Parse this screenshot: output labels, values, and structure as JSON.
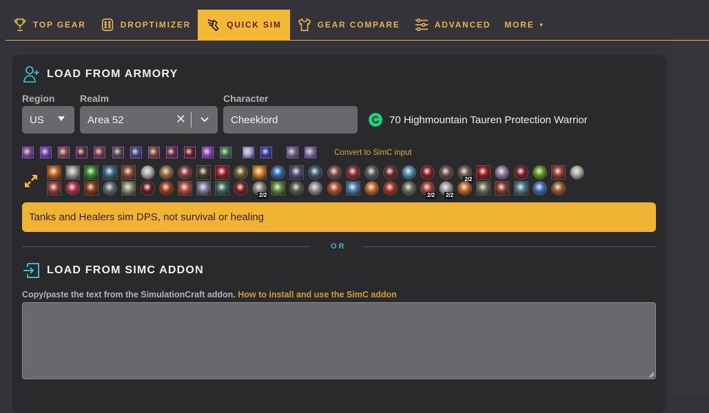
{
  "nav": {
    "items": [
      {
        "label": "TOP GEAR",
        "icon": "trophy-icon",
        "active": false
      },
      {
        "label": "DROPTIMIZER",
        "icon": "dice-icon",
        "active": false
      },
      {
        "label": "QUICK SIM",
        "icon": "winged-boot-icon",
        "active": true
      },
      {
        "label": "GEAR COMPARE",
        "icon": "shirt-icon",
        "active": false
      },
      {
        "label": "ADVANCED",
        "icon": "sliders-icon",
        "active": false
      },
      {
        "label": "MORE",
        "icon": "caret-down-icon",
        "active": false
      }
    ],
    "more_caret": "▼"
  },
  "armory": {
    "title": "LOAD FROM ARMORY",
    "region_label": "Region",
    "region_value": "US",
    "realm_label": "Realm",
    "realm_value": "Area 52",
    "realm_clear": "✕",
    "character_label": "Character",
    "character_value": "Cheeklord",
    "character_info": "70 Highmountain Tauren Protection Warrior",
    "convert_link": "Convert to SimC input",
    "gear_icons": [
      {
        "slot": "head",
        "color": "#7a4a8a"
      },
      {
        "slot": "neck",
        "color": "#6b3fa8"
      },
      {
        "slot": "shoulder",
        "color": "#8a4a3a"
      },
      {
        "slot": "back",
        "color": "#5e2a2a"
      },
      {
        "slot": "chest",
        "color": "#7a3a3a"
      },
      {
        "slot": "wrist",
        "color": "#5a4a3a"
      },
      {
        "slot": "hands",
        "color": "#3a4a7a"
      },
      {
        "slot": "waist",
        "color": "#7a4a2a"
      },
      {
        "slot": "legs",
        "color": "#6a2a3a"
      },
      {
        "slot": "feet",
        "color": "#6a1a1a"
      },
      {
        "slot": "finger1",
        "color": "#8a4ab0"
      },
      {
        "slot": "finger2",
        "color": "#3a7a3a"
      },
      {
        "slot": "trinket1",
        "color": "#a0a8c8"
      },
      {
        "slot": "trinket2",
        "color": "#2a3a9a"
      },
      {
        "slot": "main_hand",
        "color": "#6a6a7a"
      },
      {
        "slot": "off_hand",
        "color": "#7a7a9a"
      }
    ],
    "talents_row1": [
      {
        "shape": "s",
        "color": "#c8641e"
      },
      {
        "shape": "s",
        "color": "#9a9a9a"
      },
      {
        "shape": "s",
        "color": "#3a8a2a"
      },
      {
        "shape": "s",
        "color": "#3a6a8a"
      },
      {
        "shape": "s",
        "color": "#8a4a2a"
      },
      {
        "shape": "r",
        "color": "#aaaaaa"
      },
      {
        "shape": "r",
        "color": "#9a6a3a"
      },
      {
        "shape": "r",
        "color": "#8a3a3a"
      },
      {
        "shape": "s",
        "color": "#4a3a2a"
      },
      {
        "shape": "s",
        "color": "#9a1a2a"
      },
      {
        "shape": "r",
        "color": "#6a5a2a"
      },
      {
        "shape": "s",
        "color": "#d8801e"
      },
      {
        "shape": "r",
        "color": "#2a6ab8"
      },
      {
        "shape": "s",
        "color": "#5a4a7a"
      },
      {
        "shape": "r",
        "color": "#3a5a6a"
      },
      {
        "shape": "r",
        "color": "#7a4a4a"
      },
      {
        "shape": "r",
        "color": "#8a2a2a"
      },
      {
        "shape": "r",
        "color": "#5a5a5a"
      },
      {
        "shape": "r",
        "color": "#6a2a2a"
      },
      {
        "shape": "r",
        "color": "#4a8aaa"
      },
      {
        "shape": "r",
        "color": "#8a1a1a"
      },
      {
        "shape": "r",
        "color": "#6a4a4a"
      },
      {
        "shape": "r",
        "color": "#6a5a4a",
        "badge": "2/2"
      },
      {
        "shape": "s",
        "color": "#9a1a1a"
      },
      {
        "shape": "r",
        "color": "#8a7a9a"
      },
      {
        "shape": "r",
        "color": "#7a1a2a"
      },
      {
        "shape": "r",
        "color": "#5a9a1a"
      },
      {
        "shape": "s",
        "color": "#9a3a2a"
      },
      {
        "shape": "r",
        "color": "#b0a8a0"
      }
    ],
    "talents_row2": [
      {
        "shape": "s",
        "color": "#9a3a3a"
      },
      {
        "shape": "r",
        "color": "#b82a4a"
      },
      {
        "shape": "s",
        "color": "#8a3a1a"
      },
      {
        "shape": "r",
        "color": "#5a6a6a"
      },
      {
        "shape": "s",
        "color": "#8a8a6a"
      },
      {
        "shape": "r",
        "color": "#6a1a1a"
      },
      {
        "shape": "r",
        "color": "#a83a1a"
      },
      {
        "shape": "s",
        "color": "#b84a3a"
      },
      {
        "shape": "s",
        "color": "#7a7a9a"
      },
      {
        "shape": "s",
        "color": "#3a6a5a"
      },
      {
        "shape": "r",
        "color": "#7a1a1a"
      },
      {
        "shape": "r",
        "color": "#8a7a7a",
        "badge": "2/2"
      },
      {
        "shape": "s",
        "color": "#5a8a3a"
      },
      {
        "shape": "r",
        "color": "#5a5a4a"
      },
      {
        "shape": "r",
        "color": "#8a8a8a"
      },
      {
        "shape": "r",
        "color": "#b84a2a"
      },
      {
        "shape": "s",
        "color": "#4a7aaa"
      },
      {
        "shape": "r",
        "color": "#c8641e"
      },
      {
        "shape": "r",
        "color": "#a8301a"
      },
      {
        "shape": "r",
        "color": "#6a6a5a"
      },
      {
        "shape": "r",
        "color": "#a83a2a",
        "badge": "2/2"
      },
      {
        "shape": "r",
        "color": "#9a9a9a",
        "badge": "2/2"
      },
      {
        "shape": "r",
        "color": "#c8641e"
      },
      {
        "shape": "s",
        "color": "#6a6a5a"
      },
      {
        "shape": "s",
        "color": "#8a3a2a"
      },
      {
        "shape": "s",
        "color": "#4a7a8a"
      },
      {
        "shape": "r",
        "color": "#3a6ab8"
      },
      {
        "shape": "r",
        "color": "#9a5a2a"
      }
    ]
  },
  "warning": {
    "text": "Tanks and Healers sim DPS, not survival or healing",
    "color": "#efb433"
  },
  "divider": {
    "text": "OR"
  },
  "simc": {
    "title": "LOAD FROM SIMC ADDON",
    "help_text": "Copy/paste the text from the SimulationCraft addon.",
    "help_link": "How to install and use the SimC addon",
    "textarea_value": ""
  },
  "colors": {
    "accent": "#f4b934",
    "nav_text": "#e3b553",
    "teal": "#3fb9cf",
    "success": "#23d07f"
  }
}
